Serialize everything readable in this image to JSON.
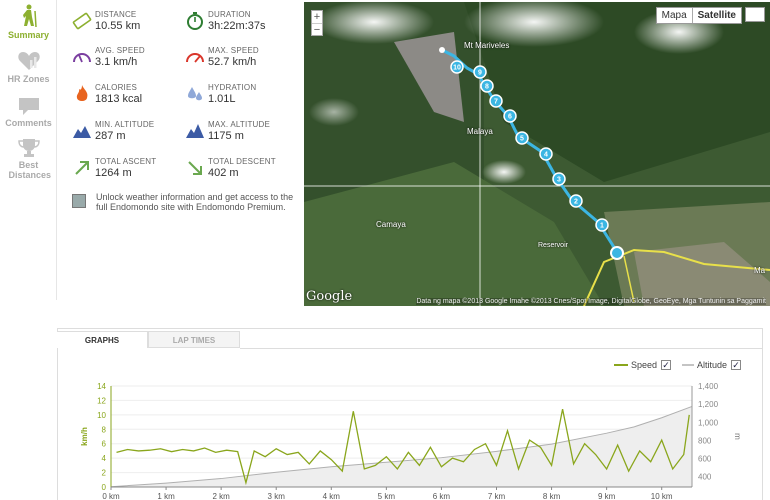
{
  "rail": [
    {
      "label": "Summary",
      "icon": "hiker-icon",
      "active": true
    },
    {
      "label": "HR Zones",
      "icon": "heart-icon",
      "active": false
    },
    {
      "label": "Comments",
      "icon": "speech-bubble-icon",
      "active": false
    },
    {
      "label": "Best Distances",
      "icon": "trophy-icon",
      "active": false
    }
  ],
  "stats": {
    "distance": {
      "label": "DISTANCE",
      "value": "10.55 km"
    },
    "duration": {
      "label": "DURATION",
      "value": "3h:22m:37s"
    },
    "avg_speed": {
      "label": "AVG. SPEED",
      "value": "3.1 km/h"
    },
    "max_speed": {
      "label": "MAX. SPEED",
      "value": "52.7 km/h"
    },
    "calories": {
      "label": "CALORIES",
      "value": "1813 kcal"
    },
    "hydration": {
      "label": "HYDRATION",
      "value": "1.01L"
    },
    "min_altitude": {
      "label": "MIN. ALTITUDE",
      "value": "287 m"
    },
    "max_altitude": {
      "label": "MAX. ALTITUDE",
      "value": "1175 m"
    },
    "total_ascent": {
      "label": "TOTAL ASCENT",
      "value": "1264 m"
    },
    "total_descent": {
      "label": "TOTAL DESCENT",
      "value": "402 m"
    }
  },
  "promo": "Unlock weather information and get access to the full Endomondo site with Endomondo Premium.",
  "map": {
    "zoom_in": "+",
    "zoom_out": "−",
    "type_map": "Mapa",
    "type_satellite": "Satellite",
    "labels": {
      "mariveles": "Mt Mariveles",
      "malaya": "Malaya",
      "camaya": "Camaya",
      "reservoir": "Reservoir",
      "ma": "Ma"
    },
    "google": "Google",
    "attribution": "Data ng mapa ©2013 Google Imahe ©2013 Cnes/Spot Image, DigitalGlobe, GeoEye, Mga Tuntunin sa Paggamit",
    "markers": [
      "1",
      "2",
      "3",
      "4",
      "5",
      "6",
      "7",
      "8",
      "9",
      "10"
    ]
  },
  "tabs": {
    "graphs": "GRAPHS",
    "lap_times": "LAP TIMES"
  },
  "legend": {
    "speed": "Speed",
    "altitude": "Altitude",
    "check": "✓"
  },
  "colors": {
    "accent": "#8db030",
    "speed": "#8aa61c",
    "altitude": "#b0b0b0",
    "route": "#3cb6e3"
  },
  "chart_data": {
    "type": "line",
    "x_ticks": [
      "0 km",
      "1 km",
      "2 km",
      "3 km",
      "4 km",
      "5 km",
      "6 km",
      "7 km",
      "8 km",
      "9 km",
      "10 km"
    ],
    "y_left_ticks": [
      "0",
      "2",
      "4",
      "6",
      "8",
      "10",
      "12",
      "14"
    ],
    "y_right_ticks": [
      "400",
      "600",
      "800",
      "1,000",
      "1,200",
      "1,400"
    ],
    "ylabel_left": "km/h",
    "ylabel_right": "m",
    "xlim": [
      0,
      10.55
    ],
    "ylim_left": [
      0,
      14
    ],
    "ylim_right": [
      287,
      1400
    ],
    "series": [
      {
        "name": "Speed",
        "axis": "left",
        "x": [
          0.1,
          0.3,
          0.5,
          0.7,
          0.9,
          1.1,
          1.3,
          1.5,
          1.7,
          1.9,
          2.1,
          2.3,
          2.45,
          2.6,
          2.8,
          3.0,
          3.2,
          3.4,
          3.6,
          3.8,
          4.0,
          4.2,
          4.4,
          4.6,
          4.8,
          5.0,
          5.2,
          5.4,
          5.6,
          5.8,
          6.0,
          6.2,
          6.4,
          6.6,
          6.8,
          7.0,
          7.2,
          7.4,
          7.6,
          7.8,
          8.0,
          8.2,
          8.4,
          8.6,
          8.8,
          9.0,
          9.2,
          9.4,
          9.6,
          9.8,
          10.0,
          10.2,
          10.4,
          10.5
        ],
        "values": [
          4.8,
          5.2,
          5.0,
          5.1,
          5.3,
          4.9,
          5.2,
          5.0,
          5.4,
          4.8,
          5.1,
          4.9,
          0.6,
          5.0,
          4.2,
          5.3,
          4.5,
          4.8,
          3.2,
          5.0,
          3.8,
          2.2,
          10.5,
          2.5,
          3.0,
          4.2,
          2.5,
          4.8,
          3.0,
          5.5,
          2.8,
          4.0,
          3.5,
          5.2,
          6.0,
          3.0,
          7.8,
          2.5,
          6.5,
          5.5,
          3.0,
          10.8,
          3.2,
          6.0,
          4.5,
          2.5,
          5.8,
          2.2,
          5.0,
          3.5,
          6.5,
          2.5,
          4.5,
          10.0
        ]
      },
      {
        "name": "Altitude",
        "axis": "right",
        "x": [
          0,
          1,
          2,
          3,
          4,
          5,
          6,
          7,
          8,
          9,
          9.5,
          10,
          10.55
        ],
        "values": [
          290,
          330,
          380,
          450,
          510,
          560,
          610,
          680,
          760,
          880,
          950,
          1050,
          1175
        ]
      }
    ]
  }
}
